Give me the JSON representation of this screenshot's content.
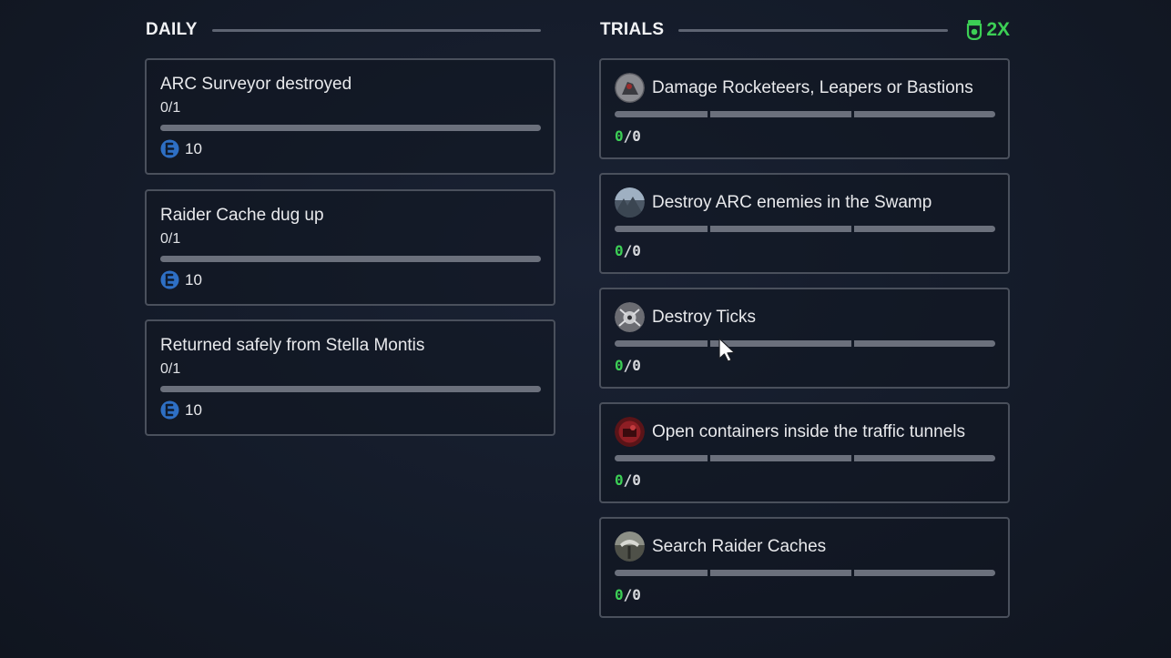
{
  "daily": {
    "title": "DAILY",
    "items": [
      {
        "title": "ARC Surveyor destroyed",
        "progress": "0/1",
        "progress_fraction": 0,
        "reward": "10",
        "reward_icon": "coin-icon"
      },
      {
        "title": "Raider Cache dug up",
        "progress": "0/1",
        "progress_fraction": 0,
        "reward": "10",
        "reward_icon": "coin-icon"
      },
      {
        "title": "Returned safely from Stella Montis",
        "progress": "0/1",
        "progress_fraction": 0,
        "reward": "10",
        "reward_icon": "coin-icon"
      }
    ]
  },
  "trials": {
    "title": "TRIALS",
    "multiplier": "2X",
    "multiplier_icon": "trophy-icon",
    "items": [
      {
        "title": "Damage Rocketeers, Leapers or Bastions",
        "current": "0",
        "sep": "/",
        "total": "0",
        "icon": "rocketeer-thumbnail"
      },
      {
        "title": "Destroy ARC enemies in the Swamp",
        "current": "0",
        "sep": "/",
        "total": "0",
        "icon": "swamp-thumbnail"
      },
      {
        "title": "Destroy Ticks",
        "current": "0",
        "sep": "/",
        "total": "0",
        "icon": "tick-thumbnail"
      },
      {
        "title": "Open containers inside the traffic tunnels",
        "current": "0",
        "sep": "/",
        "total": "0",
        "icon": "container-thumbnail"
      },
      {
        "title": "Search Raider Caches",
        "current": "0",
        "sep": "/",
        "total": "0",
        "icon": "raider-cache-thumbnail"
      }
    ]
  },
  "colors": {
    "accent_green": "#3ccf55",
    "bar_gray": "#6b707c",
    "card_border": "#4a505c",
    "coin_blue": "#2e6fc4"
  }
}
